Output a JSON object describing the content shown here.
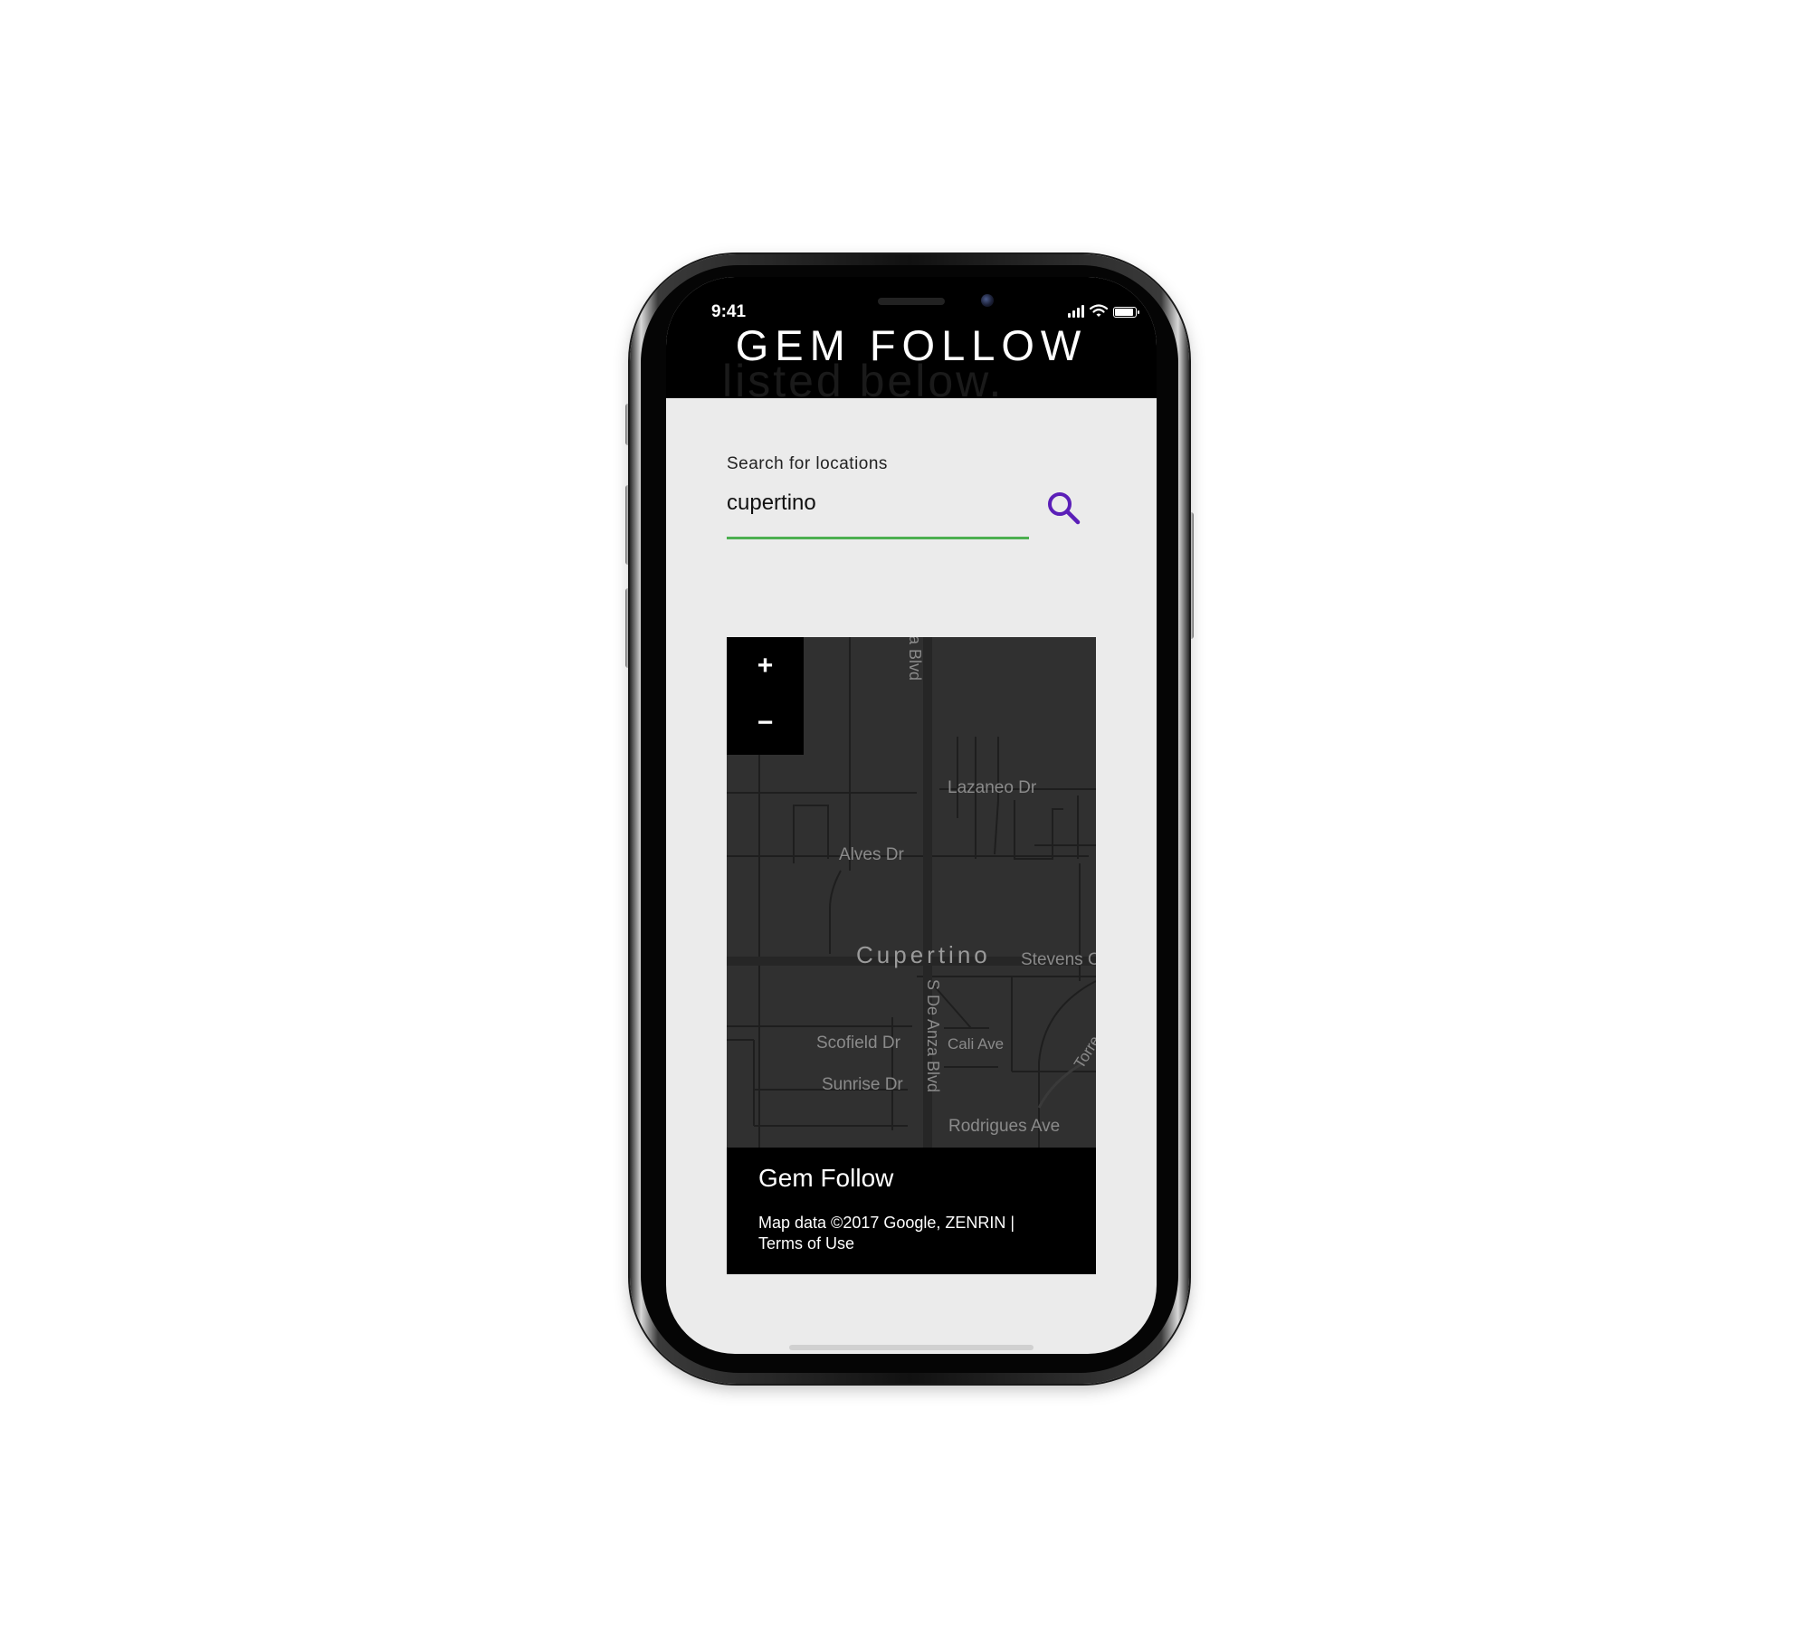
{
  "status_bar": {
    "time": "9:41",
    "signal_bars": 4,
    "battery_level": 0.9
  },
  "header": {
    "title": "GEM FOLLOW",
    "ghost_text": "listed below."
  },
  "search": {
    "label": "Search for locations",
    "value": "cupertino",
    "underline_color": "#4caf50",
    "button_icon": "search-icon",
    "icon_color": "#5b1fb8"
  },
  "map": {
    "zoom_in_label": "+",
    "zoom_out_label": "−",
    "labels": {
      "blvd_top": "a Blvd",
      "lazaneo": "Lazaneo Dr",
      "alves": "Alves Dr",
      "cupertino": "Cupertino",
      "stevens": "Stevens C",
      "scofield": "Scofield Dr",
      "de_anza": "S De Anza Blvd",
      "cali": "Cali Ave",
      "torre": "Torre",
      "sunrise": "Sunrise Dr",
      "rodrigues": "Rodrigues Ave"
    },
    "footer_title": "Gem Follow",
    "attribution_line1": "Map data ©2017 Google, ZENRIN |",
    "attribution_line2": "Terms of Use"
  },
  "colors": {
    "header_bg": "#000000",
    "screen_bg": "#ebebeb",
    "map_bg": "#303030",
    "accent_green": "#4caf50",
    "accent_purple": "#5b1fb8"
  }
}
